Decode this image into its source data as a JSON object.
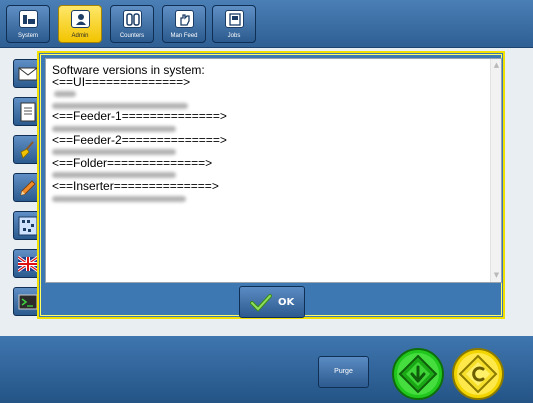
{
  "toolbar": {
    "buttons": [
      {
        "label": "System",
        "icon": "system-icon",
        "active": false
      },
      {
        "label": "Admin",
        "icon": "admin-person-icon",
        "active": true
      },
      {
        "label": "Counters",
        "icon": "counters-icon",
        "active": false
      },
      {
        "label": "Man Feed",
        "icon": "hand-icon",
        "active": false
      },
      {
        "label": "Jobs",
        "icon": "jobs-icon",
        "active": false
      }
    ]
  },
  "sidebar": {
    "items": [
      {
        "icon": "envelope-icon"
      },
      {
        "icon": "document-icon"
      },
      {
        "icon": "broom-icon"
      },
      {
        "icon": "pencil-icon"
      },
      {
        "icon": "barcode-grid-icon"
      },
      {
        "icon": "uk-flag-icon"
      },
      {
        "icon": "terminal-icon"
      }
    ]
  },
  "dialog": {
    "lines": [
      "Software versions in system:",
      "<==UI==============>",
      "<==Feeder-1==============>",
      "<==Feeder-2==============>",
      "<==Folder==============>",
      "<==Inserter==============>"
    ],
    "ok_label": "OK"
  },
  "bottom": {
    "purge_label": "Purge",
    "start_icon": "start-diamond-icon",
    "continue_icon": "continue-diamond-icon"
  },
  "colors": {
    "toolbar_blue": "#2f5f93",
    "active_yellow": "#f2c400",
    "dialog_border": "#f2e100",
    "start_green": "#22c71d",
    "continue_yellow": "#f2d400"
  }
}
